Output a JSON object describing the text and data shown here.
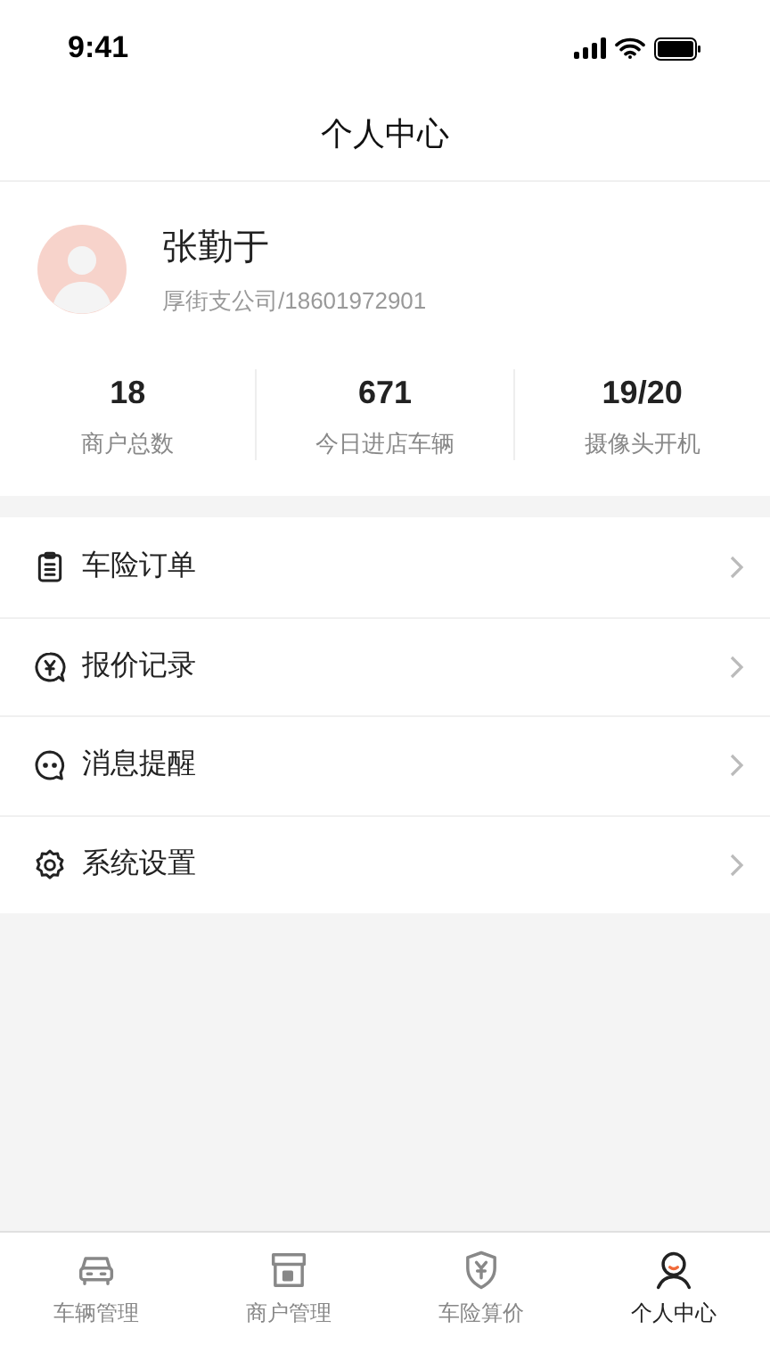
{
  "status_bar": {
    "time": "9:41"
  },
  "header": {
    "title": "个人中心"
  },
  "profile": {
    "name": "张勤于",
    "subtitle": "厚街支公司/18601972901"
  },
  "stats": [
    {
      "value": "18",
      "label": "商户总数"
    },
    {
      "value": "671",
      "label": "今日进店车辆"
    },
    {
      "value": "19/20",
      "label": "摄像头开机"
    }
  ],
  "menu": [
    {
      "kind": "clipboard",
      "label": "车险订单"
    },
    {
      "kind": "quote",
      "label": "报价记录"
    },
    {
      "kind": "message",
      "label": "消息提醒"
    },
    {
      "kind": "settings",
      "label": "系统设置"
    }
  ],
  "tabs": [
    {
      "kind": "car",
      "label": "车辆管理",
      "selected": false
    },
    {
      "kind": "store",
      "label": "商户管理",
      "selected": false
    },
    {
      "kind": "shield",
      "label": "车险算价",
      "selected": false
    },
    {
      "kind": "person",
      "label": "个人中心",
      "selected": true
    }
  ]
}
